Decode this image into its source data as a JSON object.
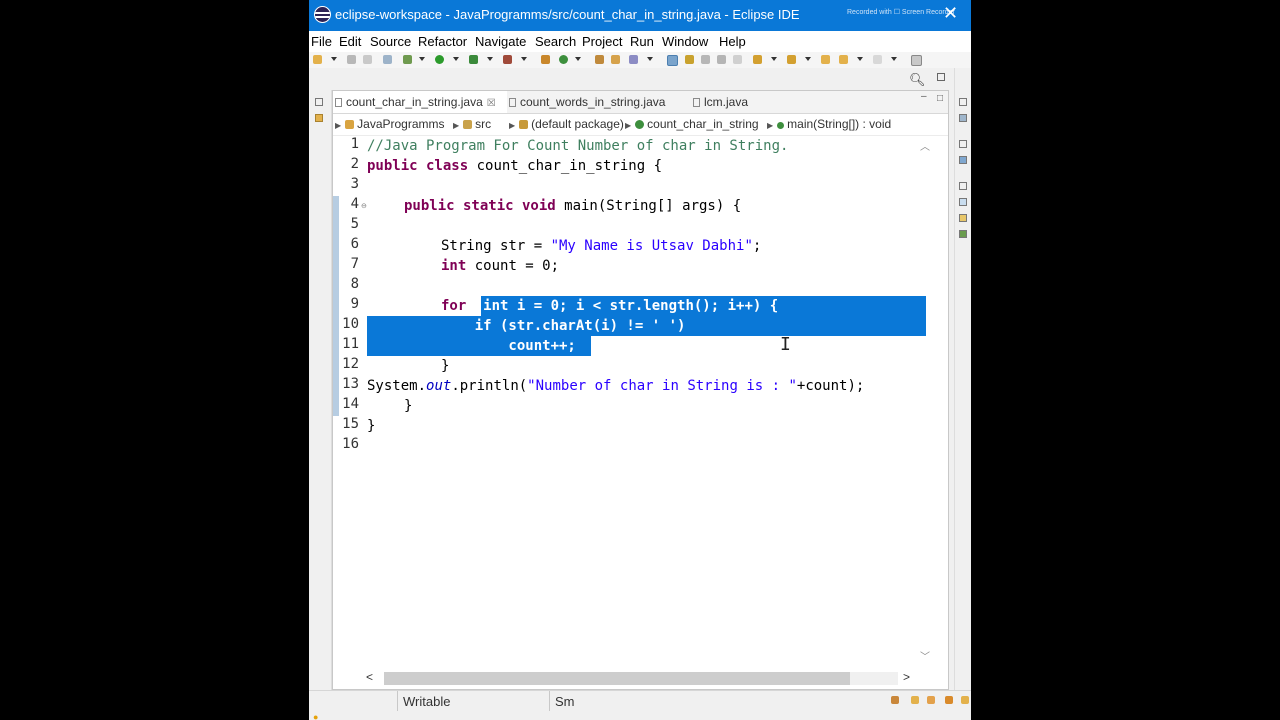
{
  "window": {
    "title": "eclipse-workspace - JavaProgramms/src/count_char_in_string.java - Eclipse IDE",
    "recorder_text": "Recorded with ☐ Screen Recorder"
  },
  "menu": [
    "File",
    "Edit",
    "Source",
    "Refactor",
    "Navigate",
    "Search",
    "Project",
    "Run",
    "Window",
    "Help"
  ],
  "tabs": [
    {
      "label": "count_char_in_string.java",
      "active": true
    },
    {
      "label": "count_words_in_string.java",
      "active": false
    },
    {
      "label": "lcm.java",
      "active": false
    }
  ],
  "tab_close_glyph": "☒",
  "breadcrumb": [
    "JavaProgramms",
    "src",
    "(default package)",
    "count_char_in_string",
    "main(String[]) : void"
  ],
  "code": {
    "line_numbers": [
      "1",
      "2",
      "3",
      "4",
      "5",
      "6",
      "7",
      "8",
      "9",
      "10",
      "11",
      "12",
      "13",
      "14",
      "15",
      "16"
    ],
    "line1_comment": "//Java Program For Count Number of char in String.",
    "line2_kw": "public class",
    "line2_rest": " count_char_in_string {",
    "line4_kw": "public static void",
    "line4_rest": " main(String[] args) {",
    "line6_a": "String str = ",
    "line6_str": "\"My Name is Utsav Dabhi\"",
    "line6_end": ";",
    "line7_kw": "int",
    "line7_rest": " count = 0;",
    "line9_kw": "for",
    "line9_sel": " (int i = 0; i < str.length(); i++) {",
    "line10_sel": "    if (str.charAt(i) != ' ')",
    "line11_sel": "        count++;",
    "line12": "}",
    "line13_a": "System.",
    "line13_fld": "out",
    "line13_b": ".println(",
    "line13_str": "\"Number of char in String is : \"",
    "line13_end": "+count);",
    "line14": "}",
    "line15": "}"
  },
  "status": {
    "writable": "Writable",
    "insert_mode": "Sm"
  },
  "colors": {
    "titlebar": "#0a78d7",
    "selection": "#0a78d7",
    "keyword": "#7f0055",
    "comment": "#3f7f5f",
    "string": "#2a00ff"
  },
  "icons": [
    "search-icon",
    "close-icon",
    "java-file-icon",
    "package-icon",
    "class-icon",
    "method-icon"
  ]
}
